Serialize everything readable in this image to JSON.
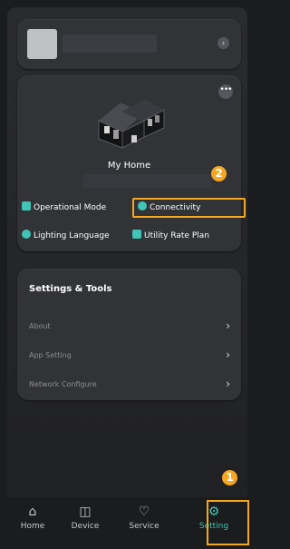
{
  "home": {
    "title": "My Home",
    "options": {
      "operational_mode": "Operational Mode",
      "connectivity": "Connectivity",
      "lighting_language": "Lighting Language",
      "utility_rate_plan": "Utility Rate Plan"
    },
    "badge": "2"
  },
  "settings": {
    "title": "Settings & Tools",
    "items": [
      {
        "label": "About"
      },
      {
        "label": "App Setting"
      },
      {
        "label": "Network Configure"
      }
    ]
  },
  "nav": {
    "tabs": [
      {
        "label": "Home",
        "icon": "house-icon"
      },
      {
        "label": "Device",
        "icon": "device-icon"
      },
      {
        "label": "Service",
        "icon": "heart-hand-icon"
      },
      {
        "label": "Setting",
        "icon": "gear-icon"
      }
    ],
    "active": "Setting",
    "badge": "1"
  },
  "colors": {
    "accent": "#3fc4b6",
    "highlight": "#f5a623",
    "background": "#1b1c1e",
    "card": "#323337"
  }
}
